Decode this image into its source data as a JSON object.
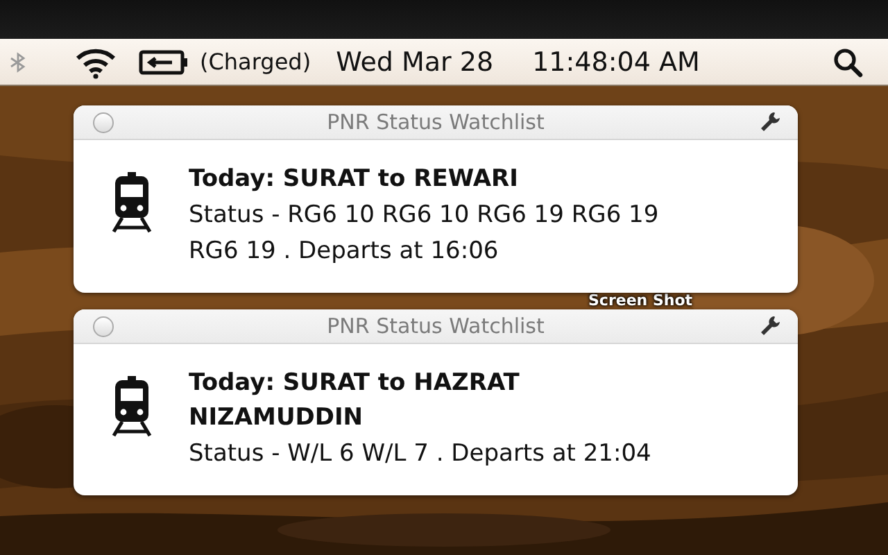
{
  "menu_bar": {
    "battery_status": "(Charged)",
    "date": "Wed Mar 28",
    "time": "11:48:04 AM"
  },
  "desktop_icon_label": "Screen Shot",
  "notifications": [
    {
      "app": "PNR Status Watchlist",
      "title": "Today: SURAT to REWARI",
      "message": "Status - RG6 10 RG6 10 RG6 19 RG6 19 RG6 19 . Departs at 16:06"
    },
    {
      "app": "PNR Status Watchlist",
      "title": "Today: SURAT to HAZRAT NIZAMUDDIN",
      "message": "Status - W/L 6 W/L 7 . Departs at 21:04"
    }
  ]
}
